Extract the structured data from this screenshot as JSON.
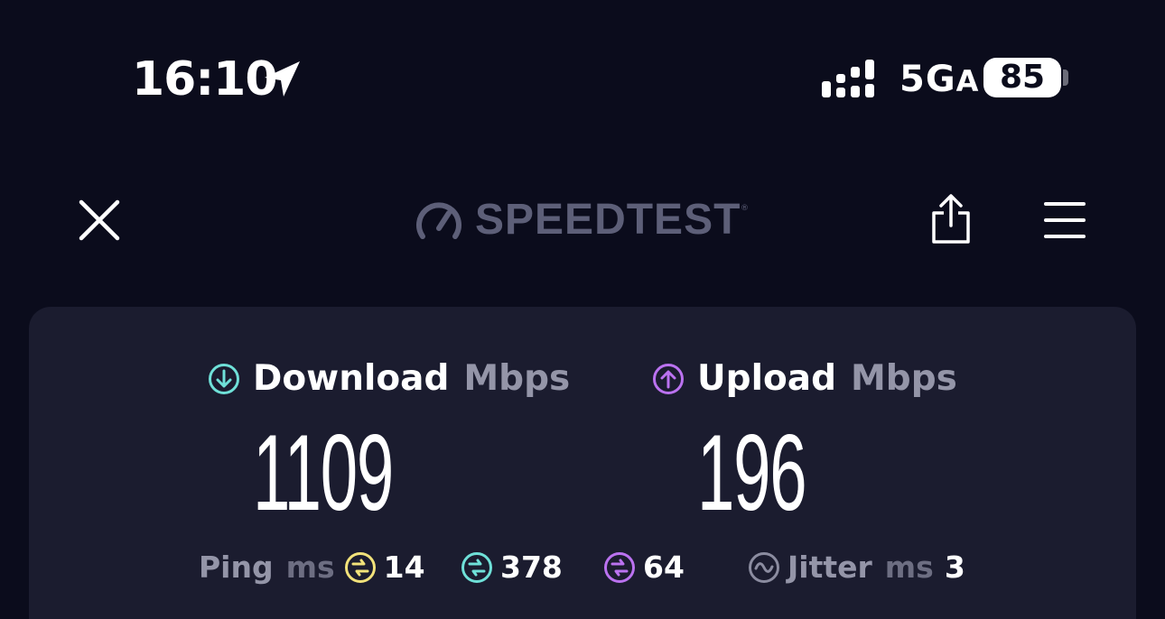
{
  "status_bar": {
    "time": "16:10",
    "network": "5G",
    "network_suffix": "A",
    "battery": "85",
    "icons": [
      "location-arrow-icon",
      "signal-icon"
    ]
  },
  "header": {
    "logo_text": "SPEEDTEST",
    "logo_mark": "®",
    "icons": [
      "close-icon",
      "speedometer-icon",
      "share-icon",
      "menu-icon"
    ]
  },
  "results": {
    "download": {
      "label": "Download",
      "unit": "Mbps",
      "value": "1109",
      "color": "#6fe0d8"
    },
    "upload": {
      "label": "Upload",
      "unit": "Mbps",
      "value": "196",
      "color": "#bb72f0"
    }
  },
  "latency": {
    "ping_label": "Ping",
    "ping_unit": "ms",
    "idle": {
      "value": "14",
      "color": "#f2e27a"
    },
    "download": {
      "value": "378",
      "color": "#6fe0d8"
    },
    "upload": {
      "value": "64",
      "color": "#bb72f0"
    },
    "jitter_label": "Jitter",
    "jitter_unit": "ms",
    "jitter_value": "3",
    "jitter_color": "#8b8ca0"
  },
  "colors": {
    "background": "#0b0c1c",
    "card": "#1b1c2f",
    "logo": "#5d5f78"
  }
}
